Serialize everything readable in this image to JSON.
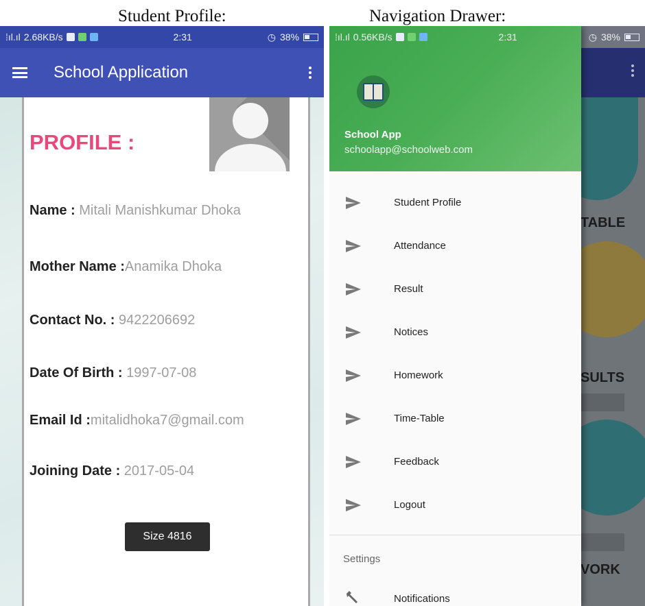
{
  "captions": {
    "left": "Student Profile:",
    "right": "Navigation Drawer:"
  },
  "left_phone": {
    "status": {
      "network": "2.68KB/s",
      "time": "2:31",
      "battery": "38%"
    },
    "appbar": {
      "title": "School Application"
    },
    "profile": {
      "heading": "PROFILE :",
      "fields": [
        {
          "label": "Name :",
          "value": " Mitali Manishkumar Dhoka"
        },
        {
          "label": "Mother Name  :",
          "value": "Anamika Dhoka"
        },
        {
          "label": "Contact No. :",
          "value": " 9422206692"
        },
        {
          "label": "Date Of Birth :",
          "value": " 1997-07-08"
        },
        {
          "label": "Email Id :",
          "value": "mitalidhoka7@gmail.com"
        },
        {
          "label": "Joining Date :",
          "value": " 2017-05-04"
        }
      ],
      "size_chip": "Size  4816"
    }
  },
  "right_phone": {
    "status": {
      "network": "0.56KB/s",
      "time": "2:31",
      "battery": "38%"
    },
    "drawer": {
      "name": "School App",
      "email": "schoolapp@schoolweb.com",
      "items": [
        "Student Profile",
        "Attendance",
        "Result",
        "Notices",
        "Homework",
        "Time-Table",
        "Feedback",
        "Logout"
      ],
      "settings_header": "Settings",
      "notifications": "Notifications"
    },
    "background_labels": [
      "TABLE",
      "SULTS",
      "VORK"
    ],
    "colors": {
      "drawer_header": "#4aae55",
      "appbar": "#3f51b5",
      "profile_heading": "#e64a7a"
    }
  }
}
